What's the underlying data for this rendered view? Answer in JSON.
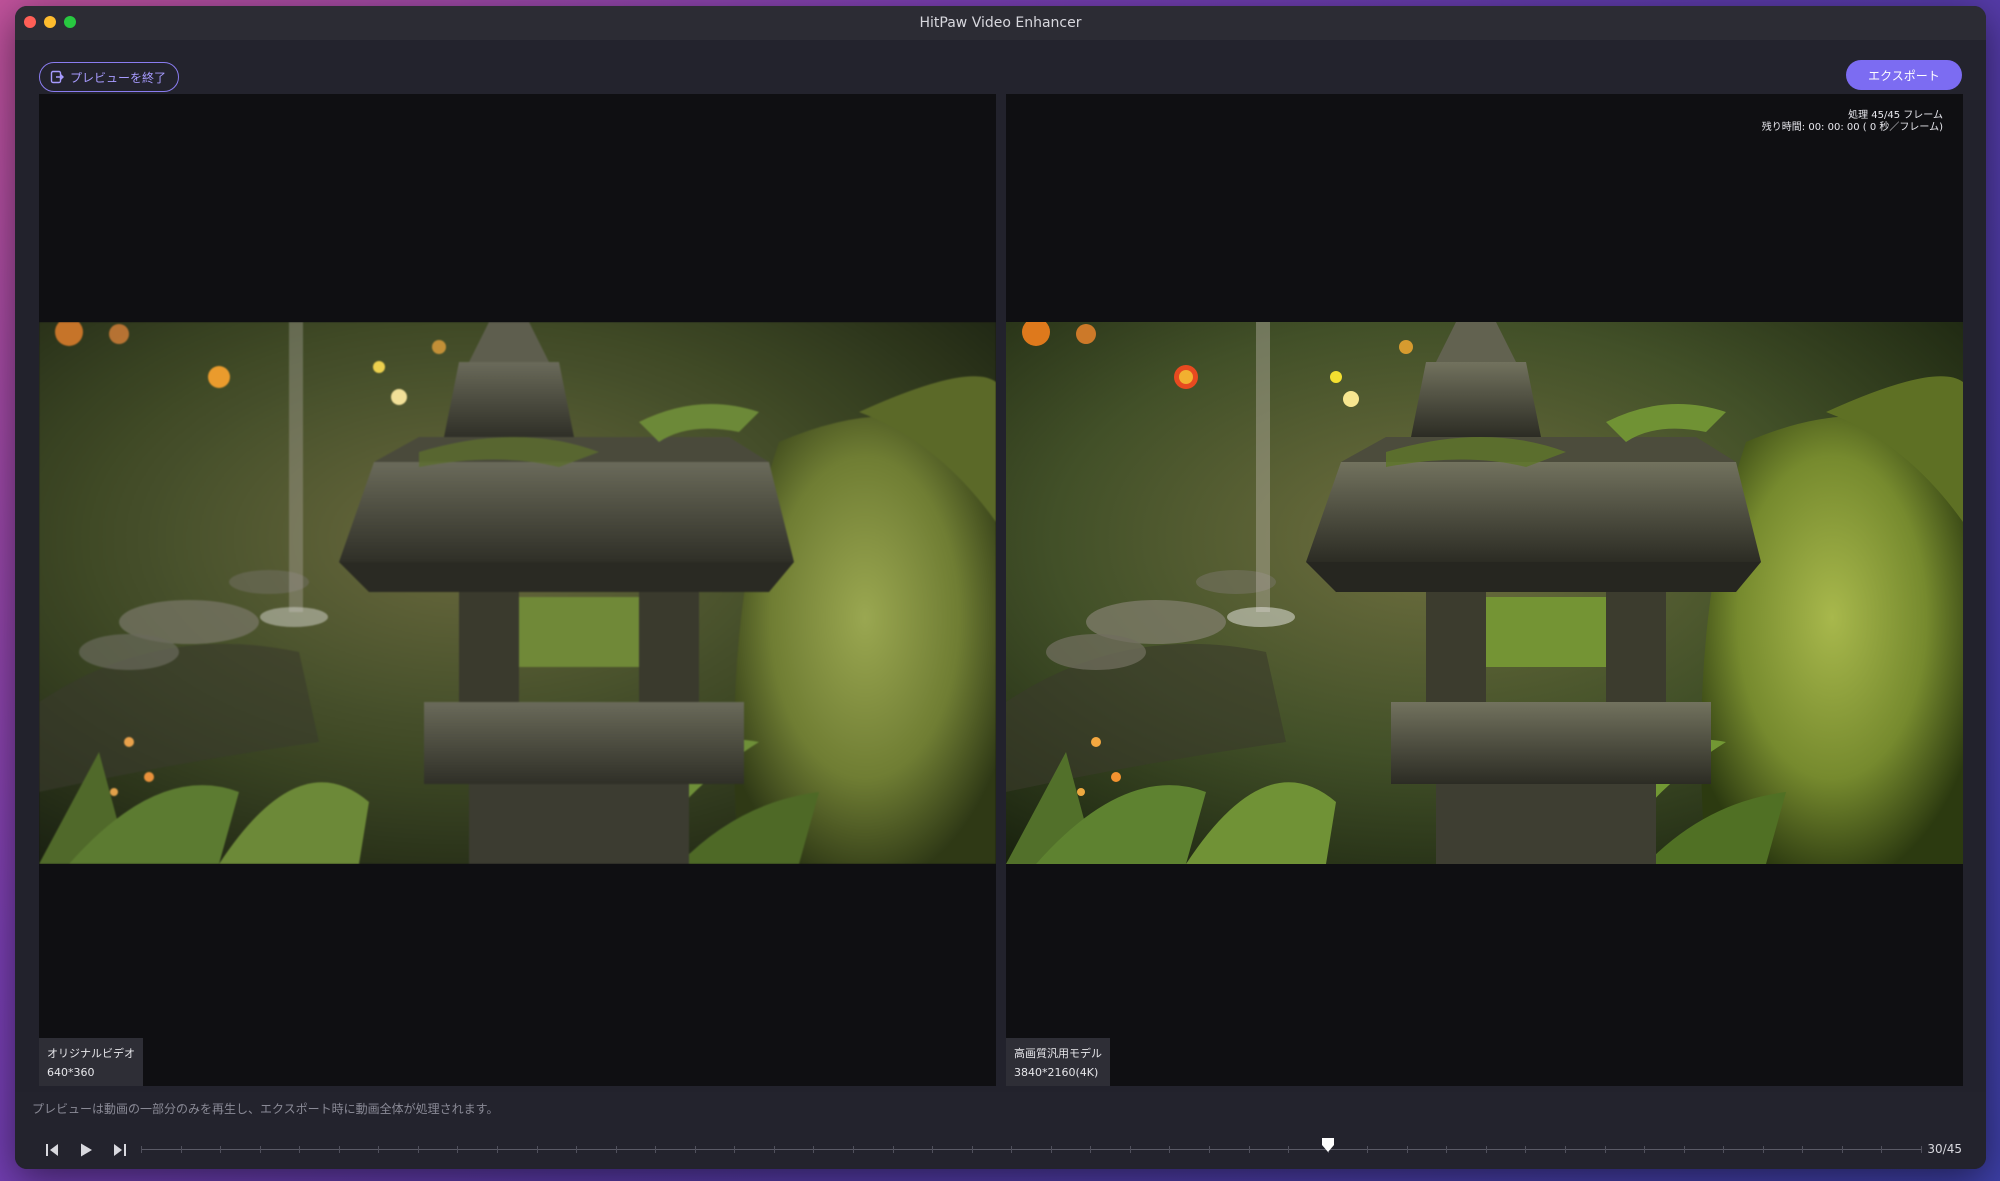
{
  "window": {
    "title": "HitPaw Video Enhancer"
  },
  "toolbar": {
    "exit_label": "プレビューを終了",
    "export_label": "エクスポート"
  },
  "left_panel": {
    "name": "オリジナルビデオ",
    "resolution": "640*360"
  },
  "right_panel": {
    "name": "高画質汎用モデル",
    "resolution": "3840*2160(4K)",
    "progress_line1": "処理 45/45 フレーム",
    "progress_line2": "残り時間: 00: 00: 00 ( 0 秒／フレーム)"
  },
  "footer": {
    "note": "プレビューは動画の一部分のみを再生し、エクスポート時に動画全体が処理されます。",
    "frame_count": "30/45",
    "current_frame": 30,
    "total_frames": 45
  },
  "icons": {
    "exit": "exit-icon",
    "prev_frame": "step-back-icon",
    "play": "play-icon",
    "next_frame": "step-forward-icon",
    "playhead": "playhead-marker-icon"
  },
  "colors": {
    "accent": "#7c6cf2",
    "accent_outline": "#8a7cf0",
    "panel_bg": "#0f0f12",
    "window_bg": "#22222c"
  }
}
